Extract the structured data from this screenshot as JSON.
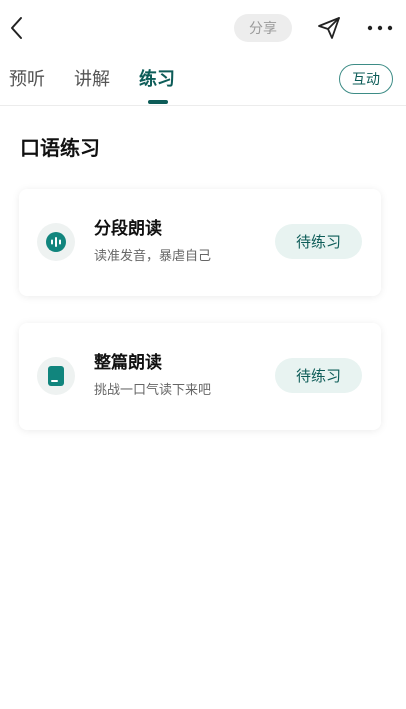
{
  "header": {
    "share_label": "分享",
    "icons": {
      "back": "chevron-left-icon",
      "send": "paper-plane-icon",
      "more": "more-dots-icon"
    }
  },
  "tabs": [
    {
      "label": "预听",
      "active": false
    },
    {
      "label": "讲解",
      "active": false
    },
    {
      "label": "练习",
      "active": true
    }
  ],
  "interact_label": "互动",
  "section": {
    "title": "口语练习"
  },
  "cards": [
    {
      "title": "分段朗读",
      "subtitle": "读准发音，暴虐自己",
      "button": "待练习",
      "icon": "audio-waveform-icon"
    },
    {
      "title": "整篇朗读",
      "subtitle": "挑战一口气读下来吧",
      "button": "待练习",
      "icon": "document-icon"
    }
  ],
  "colors": {
    "accent": "#0d5c58",
    "icon_teal": "#11857d",
    "pill_bg": "#e8f3f1"
  }
}
